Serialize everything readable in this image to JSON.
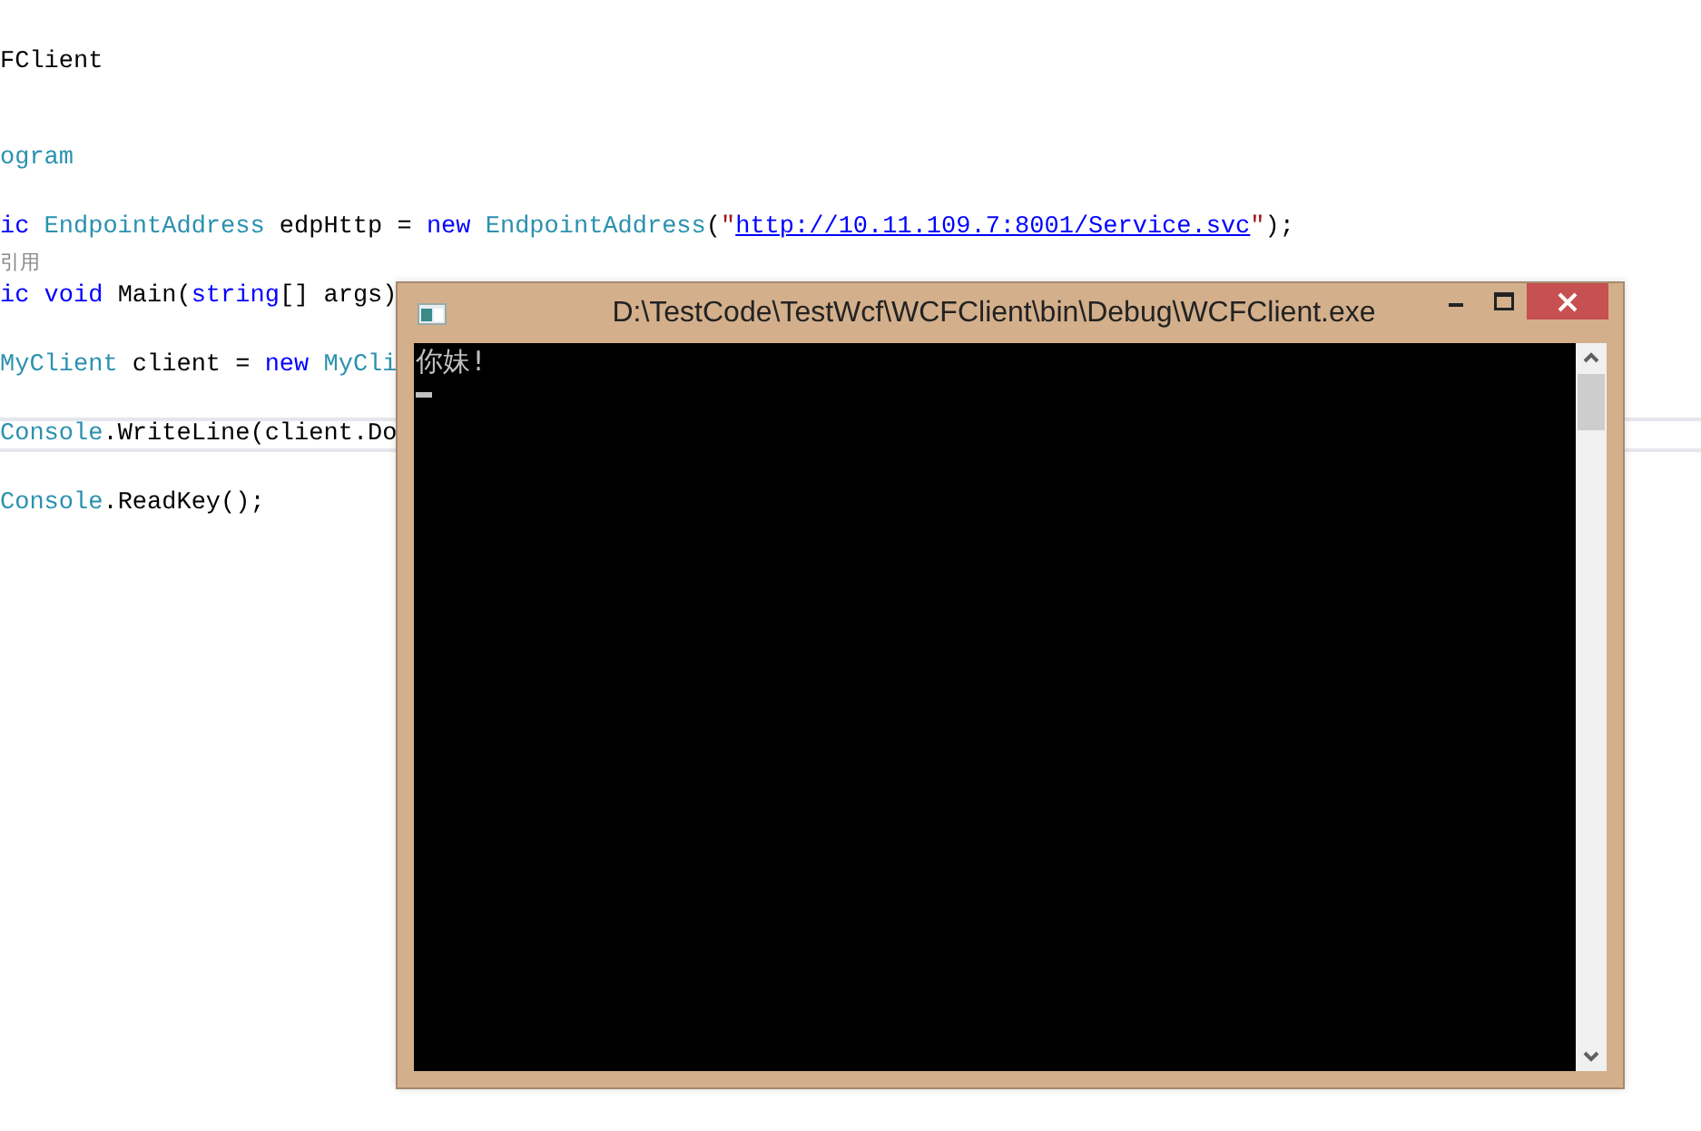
{
  "editor": {
    "lines": [
      {
        "kind": "code",
        "current": false,
        "tokens": [
          {
            "kind": "plain",
            "text": "FClient"
          }
        ]
      },
      {
        "kind": "code",
        "current": false,
        "tokens": [
          {
            "kind": "type",
            "text": "ogram"
          }
        ]
      },
      {
        "kind": "code",
        "current": false,
        "tokens": [
          {
            "kind": "keyword",
            "text": "ic"
          },
          {
            "kind": "type",
            "text": " EndpointAddress"
          },
          {
            "kind": "plain",
            "text": " edpHttp = "
          },
          {
            "kind": "keyword",
            "text": "new"
          },
          {
            "kind": "type",
            "text": " EndpointAddress"
          },
          {
            "kind": "plain",
            "text": "("
          },
          {
            "kind": "string",
            "text": "\""
          },
          {
            "kind": "link",
            "text": "http://10.11.109.7:8001/Service.svc"
          },
          {
            "kind": "string",
            "text": "\""
          },
          {
            "kind": "plain",
            "text": ");"
          }
        ]
      },
      {
        "kind": "hint",
        "current": false,
        "tokens": [
          {
            "kind": "hint",
            "text": "引用"
          }
        ]
      },
      {
        "kind": "code",
        "current": false,
        "tokens": [
          {
            "kind": "keyword",
            "text": "ic"
          },
          {
            "kind": "keyword",
            "text": " void"
          },
          {
            "kind": "plain",
            "text": " Main("
          },
          {
            "kind": "keyword",
            "text": "string"
          },
          {
            "kind": "plain",
            "text": "[] args)"
          }
        ]
      },
      {
        "kind": "code",
        "current": false,
        "tokens": [
          {
            "kind": "type",
            "text": "MyClient"
          },
          {
            "kind": "plain",
            "text": " client = "
          },
          {
            "kind": "keyword",
            "text": "new"
          },
          {
            "kind": "type",
            "text": " MyCli"
          }
        ]
      },
      {
        "kind": "code",
        "current": true,
        "tokens": [
          {
            "kind": "type",
            "text": "Console"
          },
          {
            "kind": "plain",
            "text": ".WriteLine(client.Do"
          }
        ]
      },
      {
        "kind": "code",
        "current": false,
        "tokens": [
          {
            "kind": "type",
            "text": "Console"
          },
          {
            "kind": "plain",
            "text": ".ReadKey();"
          }
        ]
      }
    ]
  },
  "console": {
    "title": "D:\\TestCode\\TestWcf\\WCFClient\\bin\\Debug\\WCFClient.exe",
    "output": [
      "你妹!"
    ]
  }
}
